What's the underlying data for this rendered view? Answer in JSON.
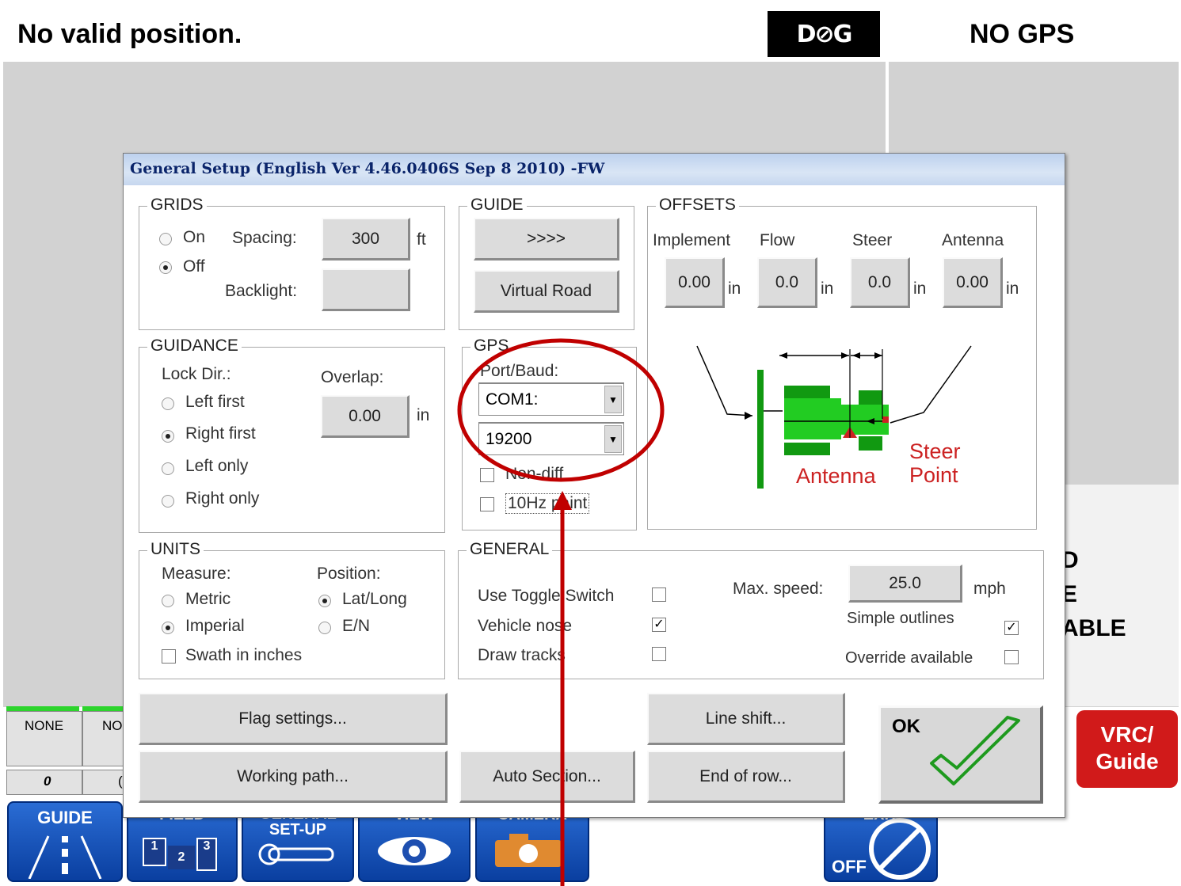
{
  "status": {
    "message": "No valid position.",
    "logo": "D⊘G",
    "gps_state": "NO GPS"
  },
  "background": {
    "warning_lines": [
      "D",
      "E",
      "ABLE"
    ],
    "lower_boxes": [
      "NONE",
      "NO"
    ],
    "lower_values": [
      "0",
      "("
    ],
    "vrc_button": [
      "VRC/",
      "Guide"
    ]
  },
  "toolbar": {
    "guide": "GUIDE",
    "field": "FIELD",
    "field_nums": [
      "1",
      "2",
      "3"
    ],
    "general_setup_lines": [
      "GENERAL",
      "SET-UP"
    ],
    "view": "VIEW",
    "camera": "CAMERA",
    "exit": "EXIT",
    "off": "OFF"
  },
  "dialog": {
    "title": "General Setup (English Ver 4.46.0406S Sep  8 2010) -FW",
    "grids": {
      "label": "GRIDS",
      "on": "On",
      "off": "Off",
      "spacing_label": "Spacing:",
      "spacing_value": "300",
      "spacing_unit": "ft",
      "backlight_label": "Backlight:",
      "selected": "Off"
    },
    "guide": {
      "label": "GUIDE",
      "more_button": ">>>>",
      "virtual_road_button": "Virtual Road"
    },
    "offsets": {
      "label": "OFFSETS",
      "columns": [
        {
          "label": "Implement",
          "value": "0.00",
          "unit": "in"
        },
        {
          "label": "Flow",
          "value": "0.0",
          "unit": "in"
        },
        {
          "label": "Steer",
          "value": "0.0",
          "unit": "in"
        },
        {
          "label": "Antenna",
          "value": "0.00",
          "unit": "in"
        }
      ],
      "diagram_antenna": "Antenna",
      "diagram_steer": "Steer",
      "diagram_point": "Point"
    },
    "guidance": {
      "label": "GUIDANCE",
      "lock_dir_label": "Lock Dir.:",
      "overlap_label": "Overlap:",
      "overlap_value": "0.00",
      "overlap_unit": "in",
      "options": [
        "Left first",
        "Right first",
        "Left only",
        "Right only"
      ],
      "selected": "Right first"
    },
    "gps": {
      "label": "GPS",
      "port_baud_label": "Port/Baud:",
      "port": "COM1:",
      "baud": "19200",
      "non_diff": "Non-diff",
      "non_diff_checked": false,
      "hz10": "10Hz paint",
      "hz10_checked": false
    },
    "units": {
      "label": "UNITS",
      "measure_label": "Measure:",
      "position_label": "Position:",
      "metric": "Metric",
      "imperial": "Imperial",
      "latlong": "Lat/Long",
      "en": "E/N",
      "swath": "Swath in inches",
      "measure_selected": "Imperial",
      "position_selected": "Lat/Long",
      "swath_checked": false
    },
    "general": {
      "label": "GENERAL",
      "use_toggle": "Use Toggle Switch",
      "use_toggle_checked": false,
      "vehicle_nose": "Vehicle nose",
      "vehicle_nose_checked": true,
      "draw_tracks": "Draw tracks",
      "draw_tracks_checked": false,
      "max_speed_label": "Max. speed:",
      "max_speed_value": "25.0",
      "max_speed_unit": "mph",
      "simple_outlines": "Simple outlines",
      "simple_outlines_checked": true,
      "override_available": "Override available",
      "override_available_checked": false
    },
    "buttons": {
      "flag_settings": "Flag settings...",
      "working_path": "Working path...",
      "auto_section": "Auto Section...",
      "line_shift": "Line shift...",
      "end_of_row": "End of row...",
      "ok": "OK"
    }
  },
  "colors": {
    "annotation": "#c00000",
    "title_bar": "#c6d7ef",
    "diagram_green": "#22cc22",
    "diagram_red": "#cc2222"
  }
}
